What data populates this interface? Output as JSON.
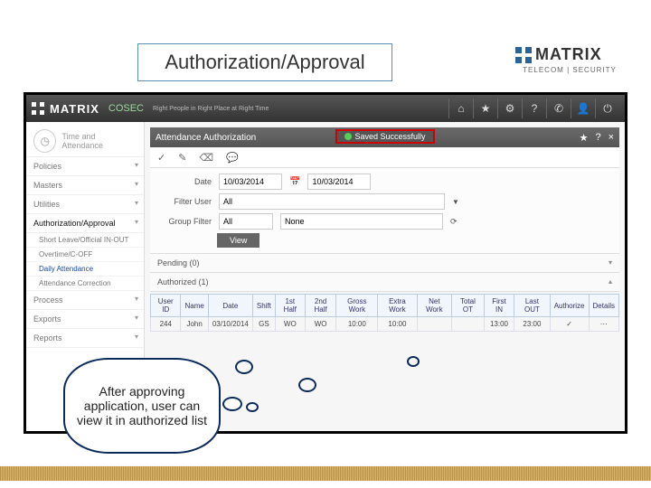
{
  "slide": {
    "title": "Authorization/Approval",
    "logo_word": "MATRIX",
    "logo_sub": "TELECOM | SECURITY"
  },
  "appbar": {
    "brand": "MATRIX",
    "app": "COSEC",
    "tagline": "Right People in Right Place at Right Time"
  },
  "sidebar": {
    "module": "Time and Attendance",
    "groups": [
      "Policies",
      "Masters",
      "Utilities"
    ],
    "active_group": "Authorization/Approval",
    "subs": [
      "Short Leave/Official IN-OUT",
      "Overtime/C-OFF",
      "Daily Attendance",
      "Attendance Correction"
    ],
    "tail": [
      "Process",
      "Exports",
      "Reports"
    ]
  },
  "panel": {
    "title": "Attendance Authorization",
    "toast": "Saved Successfully"
  },
  "filters": {
    "date_label": "Date",
    "date_from": "10/03/2014",
    "date_to": "10/03/2014",
    "filter_user_label": "Filter User",
    "filter_user_val": "All",
    "group_filter_label": "Group Filter",
    "group_filter_val": "All",
    "group_filter_extra": "None",
    "view_btn": "View"
  },
  "accordion": {
    "pending": "Pending (0)",
    "authorized": "Authorized (1)"
  },
  "grid": {
    "headers": [
      "User ID",
      "Name",
      "Date",
      "Shift",
      "1st Half",
      "2nd Half",
      "Gross Work",
      "Extra Work",
      "Net Work",
      "Total OT",
      "First IN",
      "Last OUT",
      "Authorize",
      "Details"
    ],
    "row": [
      "244",
      "John",
      "03/10/2014",
      "GS",
      "WO",
      "WO",
      "10:00",
      "10:00",
      "",
      "",
      "13:00",
      "23:00",
      "✓",
      "⋯"
    ]
  },
  "callout": "After approving application, user can view it in authorized list"
}
